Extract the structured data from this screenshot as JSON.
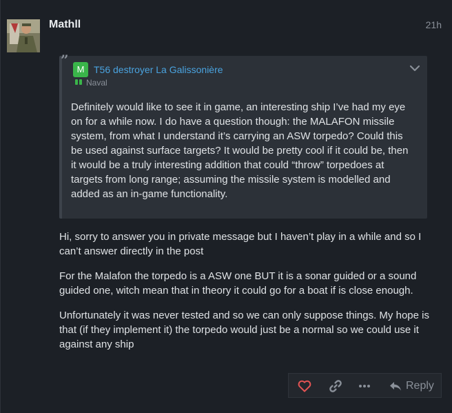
{
  "post": {
    "author": "Mathll",
    "date": "21h",
    "quote": {
      "topic_icon_letter": "M",
      "topic_title": "T56 destroyer La Galissonière",
      "category": "Naval",
      "text": "Definitely would like to see it in game, an interesting ship I’ve had my eye on for a while now. I do have a question though: the MALAFON missile system, from what I understand it’s carrying an ASW torpedo? Could this be used against surface targets? It would be pretty cool if it could be, then it would be a truly interesting addition that could “throw” torpedoes at targets from long range; assuming the missile system is modelled and added as an in-game functionality."
    },
    "paragraphs": [
      "Hi, sorry to answer you in private message but I haven’t play in a while and so I can’t answer directly in the post",
      "For the Malafon the torpedo is a ASW one BUT it is a sonar guided or a sound guided one, witch mean that in theory it could go for a boat if is close enough.",
      "Unfortunately it was never tested and so we can only suppose things. My hope is that (if they implement it) the torpedo would just be a normal so we could use it against any ship"
    ],
    "actions": {
      "like_icon": "heart-icon",
      "link_icon": "link-icon",
      "more_icon": "more-icon",
      "reply_label": "Reply"
    }
  },
  "colors": {
    "background": "#1c2026",
    "quote_bg": "#2c3138",
    "link": "#4aa3df",
    "category": "#3ab54a",
    "like": "#e45454"
  }
}
